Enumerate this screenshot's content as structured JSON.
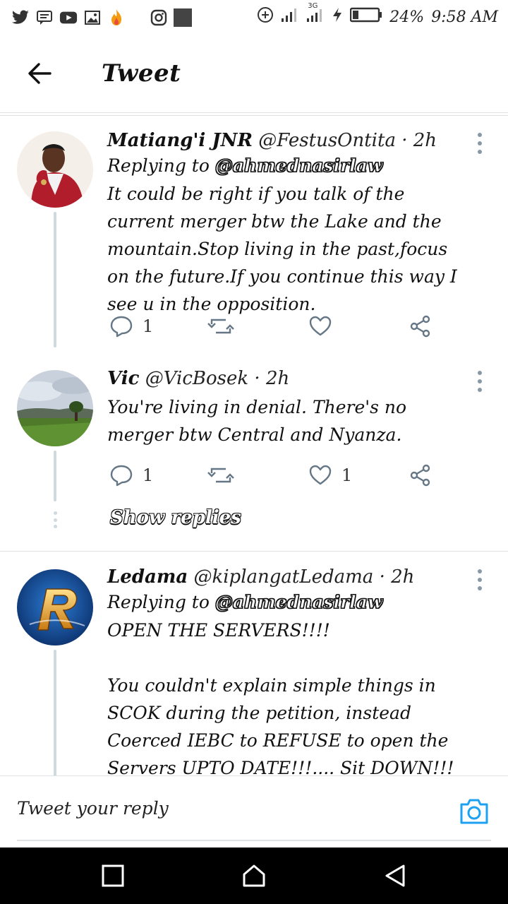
{
  "status_bar": {
    "battery": "24%",
    "time": "9:58 AM",
    "network": "3G"
  },
  "header": {
    "title": "Tweet"
  },
  "tweets": [
    {
      "name": "Matiang'i JNR",
      "handle": "@FestusOntita",
      "sep": "·",
      "time": "2h",
      "replying_prefix": "Replying to",
      "replying_to": "@ahmednasirlaw",
      "body": "It could be right if you talk of the current merger btw the Lake and the mountain.Stop living in the past,focus on the future.If you continue this way I see u in the opposition.",
      "replies": "1",
      "retweets": "",
      "likes": ""
    },
    {
      "name": "Vic",
      "handle": "@VicBosek",
      "sep": "·",
      "time": "2h",
      "body": "You're living in denial. There's no merger btw Central and Nyanza.",
      "replies": "1",
      "retweets": "",
      "likes": "1"
    },
    {
      "name": "Ledama",
      "handle": "@kiplangatLedama",
      "sep": "·",
      "time": "2h",
      "replying_prefix": "Replying to",
      "replying_to": "@ahmednasirlaw",
      "body": "OPEN THE SERVERS!!!!\n\nYou couldn't explain simple things in SCOK during the petition, instead Coerced IEBC to REFUSE to open the Servers UPTO DATE!!!.... Sit DOWN!!!"
    }
  ],
  "show_replies": "Show replies",
  "reply_bar": {
    "placeholder": "Tweet your reply"
  },
  "colors": {
    "accent": "#1da1f2",
    "thread_line": "#cfd9de",
    "divider": "#dfe3e6",
    "icon": "#657786"
  },
  "icons": {
    "back": "arrow-left-icon",
    "reply": "speech-bubble-icon",
    "retweet": "retweet-icon",
    "like": "heart-icon",
    "share": "share-icon",
    "camera": "camera-icon"
  }
}
